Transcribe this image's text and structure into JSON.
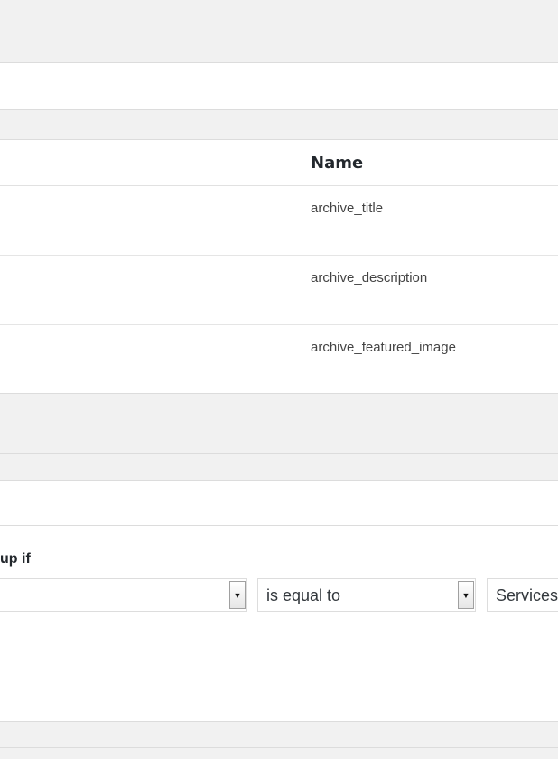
{
  "fields_table": {
    "name_header": "Name",
    "rows": [
      {
        "name": "archive_title"
      },
      {
        "name": "archive_description"
      },
      {
        "name": "archive_featured_image"
      }
    ]
  },
  "location_rules": {
    "label": "up if",
    "param_select": {
      "value": ""
    },
    "operator_select": {
      "value": "is equal to"
    },
    "value_select": {
      "value": "Services"
    }
  },
  "icons": {
    "select_arrow": "chevron-down-icon"
  }
}
